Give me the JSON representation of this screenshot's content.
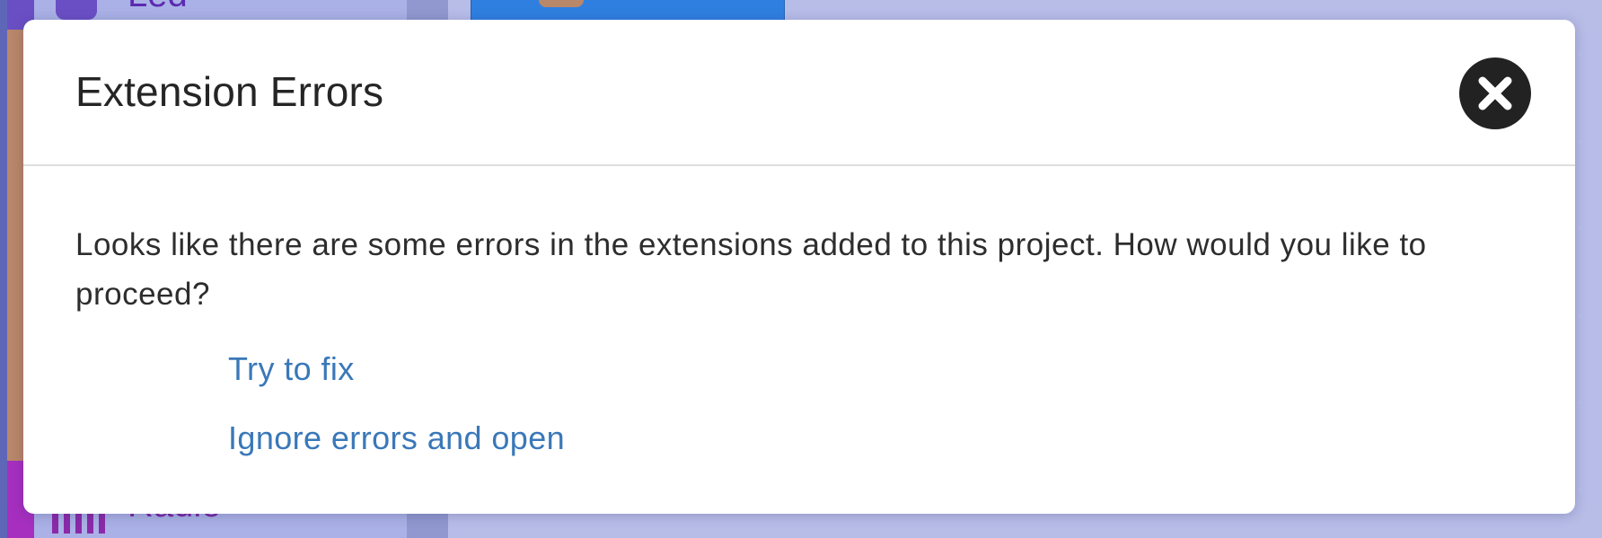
{
  "background": {
    "category_top_label": "Led",
    "category_bottom_label": "Radio"
  },
  "dialog": {
    "title": "Extension Errors",
    "close_icon": "close-icon",
    "message": "Looks like there are some errors in the extensions added to this project. How would you like to proceed?",
    "options": [
      {
        "label": "Try to fix"
      },
      {
        "label": "Ignore errors and open"
      }
    ]
  },
  "colors": {
    "link": "#3a78b8",
    "overlay": "#a3aadf",
    "close_button": "#222222"
  }
}
